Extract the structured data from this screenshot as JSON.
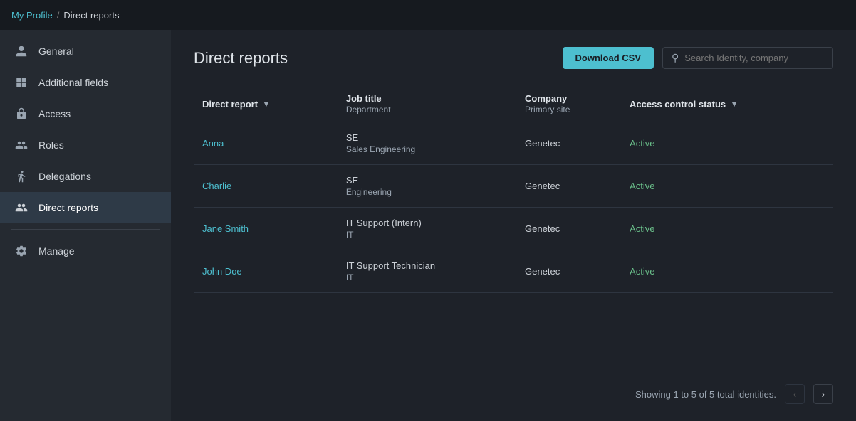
{
  "breadcrumb": {
    "parent_label": "My Profile",
    "separator": "/",
    "current_label": "Direct reports"
  },
  "sidebar": {
    "items": [
      {
        "id": "general",
        "label": "General",
        "icon": "person-icon"
      },
      {
        "id": "additional-fields",
        "label": "Additional fields",
        "icon": "grid-icon"
      },
      {
        "id": "access",
        "label": "Access",
        "icon": "lock-icon"
      },
      {
        "id": "roles",
        "label": "Roles",
        "icon": "roles-icon"
      },
      {
        "id": "delegations",
        "label": "Delegations",
        "icon": "delegation-icon"
      },
      {
        "id": "direct-reports",
        "label": "Direct reports",
        "icon": "direct-reports-icon"
      }
    ],
    "bottom_items": [
      {
        "id": "manage",
        "label": "Manage",
        "icon": "manage-icon"
      }
    ]
  },
  "page": {
    "title": "Direct reports",
    "download_btn_label": "Download CSV",
    "search_placeholder": "Search Identity, company"
  },
  "table": {
    "columns": [
      {
        "id": "direct-report",
        "label": "Direct report",
        "sub": "",
        "has_filter": true
      },
      {
        "id": "job-title",
        "label": "Job title",
        "sub": "Department",
        "has_filter": false
      },
      {
        "id": "company",
        "label": "Company",
        "sub": "Primary site",
        "has_filter": false
      },
      {
        "id": "access-status",
        "label": "Access control status",
        "sub": "",
        "has_filter": true
      }
    ],
    "rows": [
      {
        "name": "Anna",
        "job_title": "SE",
        "department": "Sales Engineering",
        "company": "Genetec",
        "primary_site": "",
        "status": "Active"
      },
      {
        "name": "Charlie",
        "job_title": "SE",
        "department": "Engineering",
        "company": "Genetec",
        "primary_site": "",
        "status": "Active"
      },
      {
        "name": "Jane Smith",
        "job_title": "IT Support (Intern)",
        "department": "IT",
        "company": "Genetec",
        "primary_site": "",
        "status": "Active"
      },
      {
        "name": "John Doe",
        "job_title": "IT Support Technician",
        "department": "IT",
        "company": "Genetec",
        "primary_site": "",
        "status": "Active"
      }
    ]
  },
  "footer": {
    "summary": "Showing 1 to 5 of 5 total identities."
  }
}
